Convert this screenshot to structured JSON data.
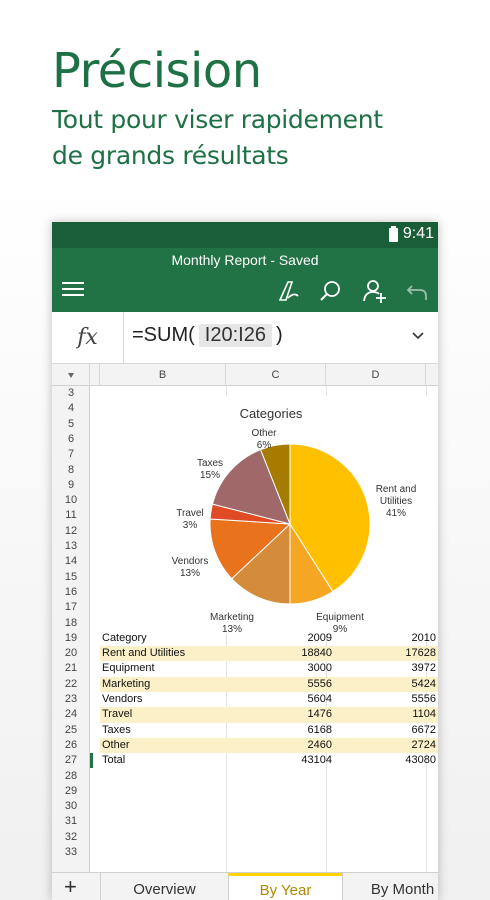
{
  "headline": {
    "title": "Précision",
    "subtitle_line1": "Tout pour viser rapidement",
    "subtitle_line2": "de grands résultats"
  },
  "status_bar": {
    "time": "9:41"
  },
  "app_bar": {
    "title": "Monthly Report - Saved",
    "icons": [
      "menu-icon",
      "draw-icon",
      "search-icon",
      "share-user-icon",
      "undo-icon"
    ]
  },
  "formula_bar": {
    "fx_label": "fx",
    "prefix": "=SUM(",
    "range": "I20:I26",
    "suffix": ")"
  },
  "columns": [
    "B",
    "C",
    "D"
  ],
  "rows_top": [
    "3",
    "4",
    "5",
    "6",
    "7",
    "8",
    "9",
    "10",
    "11",
    "12",
    "13",
    "14",
    "15",
    "16",
    "17",
    "18"
  ],
  "rows_bottom": [
    "28",
    "29",
    "30",
    "31",
    "32",
    "33"
  ],
  "chart": {
    "title": "Categories",
    "slices": [
      {
        "label": "Rent and Utilities",
        "pct": "41%",
        "value": 41,
        "color": "#ffc000"
      },
      {
        "label": "Equipment",
        "pct": "9%",
        "value": 9,
        "color": "#f5a623"
      },
      {
        "label": "Marketing",
        "pct": "13%",
        "value": 13,
        "color": "#d48b3a"
      },
      {
        "label": "Vendors",
        "pct": "13%",
        "value": 13,
        "color": "#e8731c"
      },
      {
        "label": "Travel",
        "pct": "3%",
        "value": 3,
        "color": "#e04a24"
      },
      {
        "label": "Taxes",
        "pct": "15%",
        "value": 15,
        "color": "#a06868"
      },
      {
        "label": "Other",
        "pct": "6%",
        "value": 6,
        "color": "#a67c00"
      }
    ]
  },
  "table": {
    "rows": [
      {
        "num": "19",
        "category": "Category",
        "y2009": "2009",
        "y2010": "2010",
        "alt": false
      },
      {
        "num": "20",
        "category": "Rent and Utilities",
        "y2009": "18840",
        "y2010": "17628",
        "alt": true
      },
      {
        "num": "21",
        "category": "Equipment",
        "y2009": "3000",
        "y2010": "3972",
        "alt": false
      },
      {
        "num": "22",
        "category": "Marketing",
        "y2009": "5556",
        "y2010": "5424",
        "alt": true
      },
      {
        "num": "23",
        "category": "Vendors",
        "y2009": "5604",
        "y2010": "5556",
        "alt": false
      },
      {
        "num": "24",
        "category": "Travel",
        "y2009": "1476",
        "y2010": "1104",
        "alt": true
      },
      {
        "num": "25",
        "category": "Taxes",
        "y2009": "6168",
        "y2010": "6672",
        "alt": false
      },
      {
        "num": "26",
        "category": "Other",
        "y2009": "2460",
        "y2010": "2724",
        "alt": true
      },
      {
        "num": "27",
        "category": "Total",
        "y2009": "43104",
        "y2010": "43080",
        "alt": false
      }
    ]
  },
  "sheet_tabs": {
    "add_label": "+",
    "tabs": [
      "Overview",
      "By Year",
      "By Month"
    ],
    "active": "By Year"
  },
  "colors": {
    "brand_green": "#217346",
    "status_green": "#1a5e37",
    "headline_green": "#1e7145",
    "active_tab_accent": "#ffd200"
  }
}
